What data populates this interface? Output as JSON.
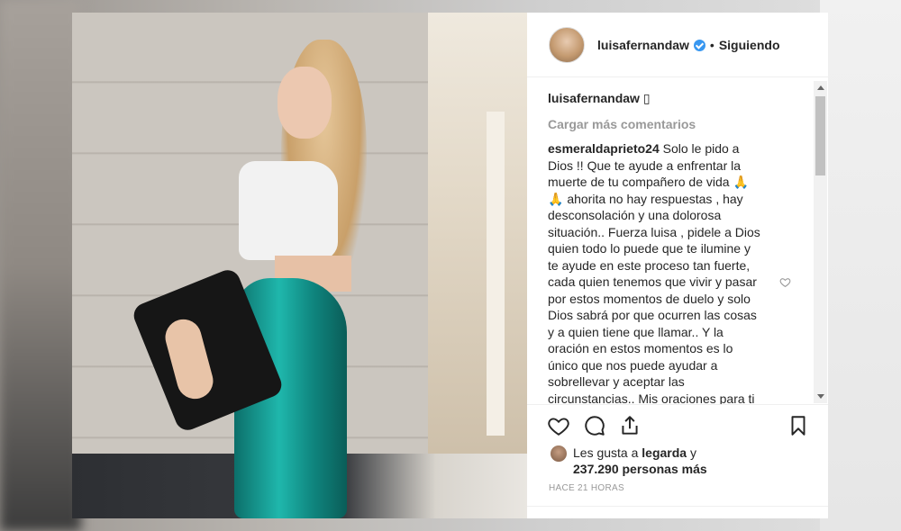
{
  "post": {
    "username": "luisafernandaw",
    "separator": "•",
    "follow_status": "Siguiendo",
    "caption_user": "luisafernandaw",
    "caption_text": "▯",
    "load_more": "Cargar más comentarios",
    "comment": {
      "user": "esmeraldaprieto24",
      "text": " Solo le pido a Dios !! Que te ayude a enfrentar la muerte de tu compañero de vida 🙏🙏 ahorita no hay respuestas , hay desconsolación y una dolorosa situación.. Fuerza luisa , pidele a Dios quien todo lo puede que te ilumine y te ayude en este proceso tan fuerte, cada quien tenemos que vivir y pasar por estos momentos de duelo y solo Dios sabrá por que ocurren las cosas y a quien tiene que llamar.. Y la oración en estos momentos es lo único que nos puede ayudar a sobrellevar y aceptar las circunstancias.. Mis oraciones para ti Dios te bendiga gigantescamente Luisa y te de"
    },
    "likes": {
      "prefix": "Les gusta a ",
      "user": "legarda",
      "connector": " y",
      "count": "237.290 personas más"
    },
    "timestamp": "HACE 21 HORAS"
  },
  "icons": {
    "verified": "verified-badge-icon",
    "heart": "heart-icon",
    "comment": "comment-icon",
    "share": "share-icon",
    "bookmark": "bookmark-icon",
    "comment_heart": "heart-small-icon"
  },
  "colors": {
    "verified": "#3897f0",
    "muted": "#999999",
    "text": "#262626"
  }
}
